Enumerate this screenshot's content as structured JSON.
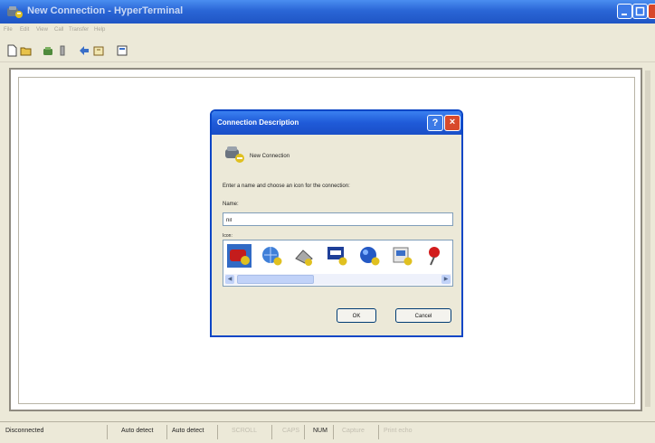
{
  "window": {
    "title": "New Connection - HyperTerminal",
    "menu": [
      "File",
      "Edit",
      "View",
      "Call",
      "Transfer",
      "Help"
    ]
  },
  "toolbar": {
    "tools": [
      "new-icon",
      "open-icon",
      "connect-icon",
      "disconnect-icon",
      "send-icon",
      "receive-icon",
      "properties-icon"
    ]
  },
  "dialog": {
    "title": "Connection Description",
    "help_label": "?",
    "close_label": "×",
    "header_text": "New Connection",
    "instruction": "Enter a name and choose an icon for the connection:",
    "name_label": "Name:",
    "name_value": "nil",
    "icon_label": "Icon:",
    "icons": [
      "connection-icon-red-phone",
      "connection-icon-globe",
      "connection-icon-phone",
      "connection-icon-mci",
      "connection-icon-globe-2",
      "connection-icon-folder",
      "connection-icon-pin"
    ],
    "scroll_left": "◀",
    "scroll_right": "▶",
    "ok_label": "OK",
    "cancel_label": "Cancel"
  },
  "status": {
    "items": [
      {
        "label": "Disconnected",
        "dim": false
      },
      {
        "label": "Auto detect",
        "dim": false
      },
      {
        "label": "Auto detect",
        "dim": false
      },
      {
        "label": "SCROLL",
        "dim": true
      },
      {
        "label": "CAPS",
        "dim": true
      },
      {
        "label": "NUM",
        "dim": false
      },
      {
        "label": "Capture",
        "dim": true
      },
      {
        "label": "Print echo",
        "dim": true
      }
    ]
  },
  "colors": {
    "titlebar": "#2a66d6",
    "dialog_border": "#0a46c6",
    "selection": "#316ac5",
    "face": "#ece9d8"
  }
}
